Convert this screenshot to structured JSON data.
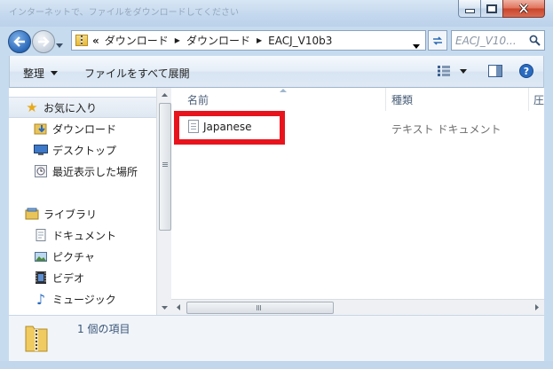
{
  "window": {
    "blurred_title_text": "インターネットで、ファイルをダウンロードしてください"
  },
  "address": {
    "overflow": "«",
    "crumbs": [
      "ダウンロード",
      "ダウンロード",
      "EACJ_V10b3"
    ],
    "search_placeholder": "EACJ_V10..."
  },
  "toolbar": {
    "organize_label": "整理",
    "extract_all_label": "ファイルをすべて展開"
  },
  "nav": {
    "favorites_label": "お気に入り",
    "favorites": [
      {
        "label": "ダウンロード",
        "icon": "download-folder-icon"
      },
      {
        "label": "デスクトップ",
        "icon": "desktop-icon"
      },
      {
        "label": "最近表示した場所",
        "icon": "recent-places-icon"
      }
    ],
    "libraries_label": "ライブラリ",
    "libraries": [
      {
        "label": "ドキュメント",
        "icon": "documents-icon"
      },
      {
        "label": "ピクチャ",
        "icon": "pictures-icon"
      },
      {
        "label": "ビデオ",
        "icon": "videos-icon"
      },
      {
        "label": "ミュージック",
        "icon": "music-icon"
      }
    ]
  },
  "content": {
    "columns": [
      "名前",
      "種類",
      "圧"
    ],
    "files": [
      {
        "name": "Japanese",
        "type": "テキスト ドキュメント"
      }
    ],
    "highlight_color": "#e8141d"
  },
  "details": {
    "item_count": "1 個の項目"
  }
}
